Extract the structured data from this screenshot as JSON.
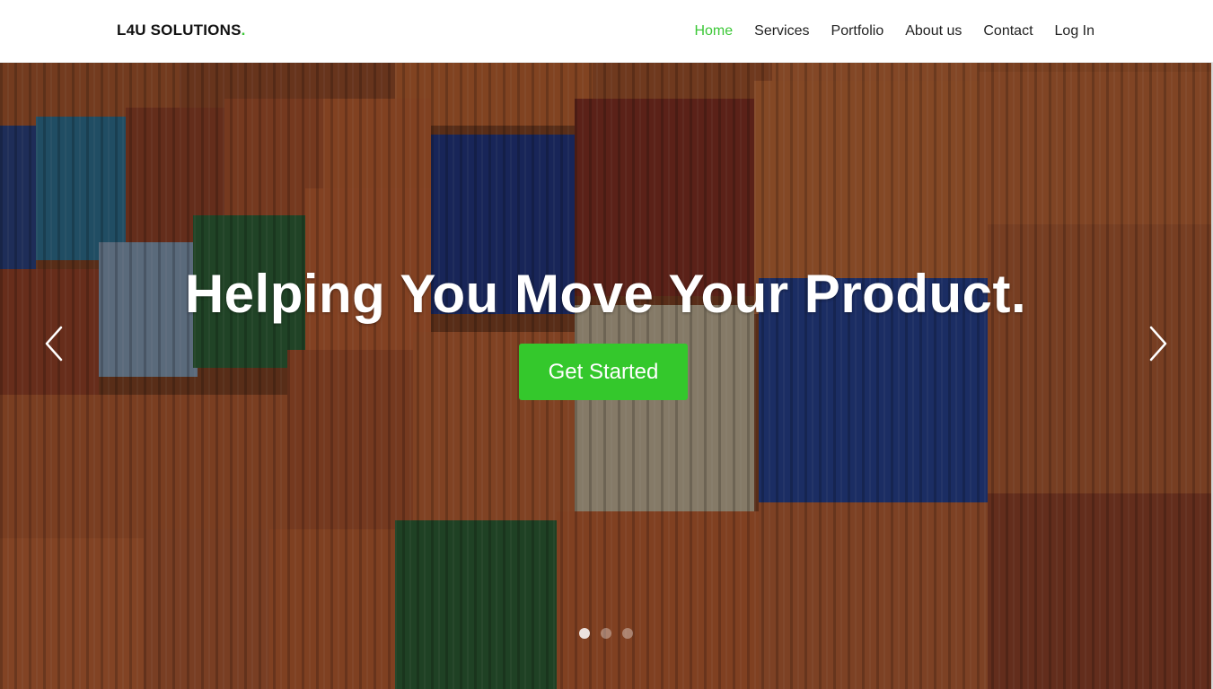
{
  "brand": {
    "name": "L4U SOLUTIONS",
    "dot": ".",
    "accent": "#3cc837"
  },
  "nav": {
    "items": [
      {
        "label": "Home",
        "active": true
      },
      {
        "label": "Services",
        "active": false
      },
      {
        "label": "Portfolio",
        "active": false
      },
      {
        "label": "About us",
        "active": false
      },
      {
        "label": "Contact",
        "active": false
      },
      {
        "label": "Log In",
        "active": false
      }
    ]
  },
  "hero": {
    "heading": "Helping You Move Your Product.",
    "cta_label": "Get Started",
    "cta_color": "#34c82c",
    "background": "stacked shipping containers photo",
    "carousel": {
      "slide_count": 3,
      "active_index": 0,
      "prev_icon": "chevron-left-icon",
      "next_icon": "chevron-right-icon"
    }
  }
}
